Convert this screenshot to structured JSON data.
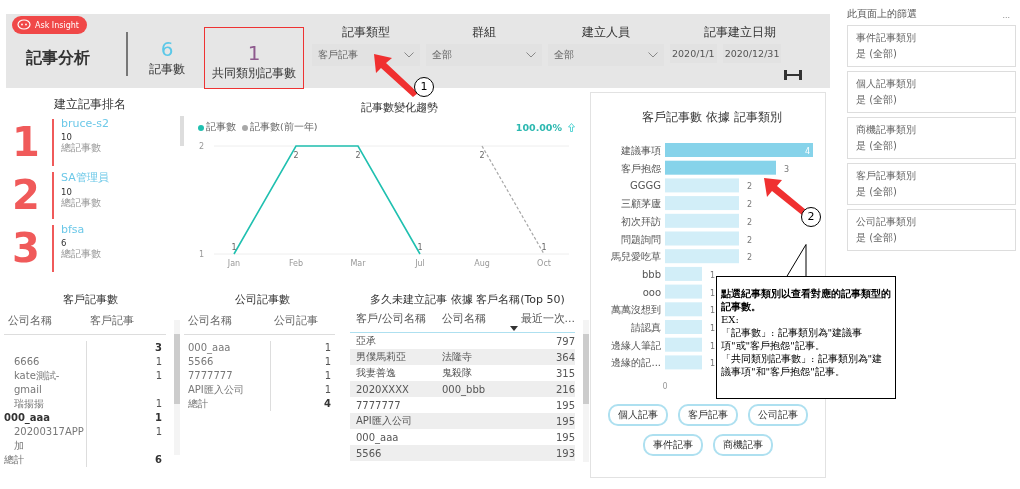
{
  "ask_button": {
    "label": "Ask Insight"
  },
  "title": "記事分析",
  "kpis": [
    {
      "value": "6",
      "label": "記事數",
      "color": "#5bc8e8",
      "boxed": false
    },
    {
      "value": "1",
      "label": "共同類別記事數",
      "color": "#8e5a8e",
      "boxed": true
    }
  ],
  "slicers": [
    {
      "kind": "dropdown",
      "title": "記事類型",
      "value": "客戶記事"
    },
    {
      "kind": "dropdown",
      "title": "群組",
      "value": "全部"
    },
    {
      "kind": "dropdown",
      "title": "建立人員",
      "value": "全部"
    },
    {
      "kind": "date_range",
      "title": "記事建立日期",
      "start": "2020/1/1",
      "end": "2020/12/31"
    }
  ],
  "ranking": {
    "title": "建立記事排名",
    "items": [
      {
        "rank": "1",
        "name": "bruce-s2",
        "count": "10",
        "caption": "總記事數"
      },
      {
        "rank": "2",
        "name": "SA管理員",
        "count": "10",
        "caption": "總記事數"
      },
      {
        "rank": "3",
        "name": "bfsa",
        "count": "6",
        "caption": "總記事數"
      }
    ]
  },
  "trend_chart": {
    "title": "記事數變化趨勢",
    "change": "100.00%",
    "chart_data": {
      "type": "line",
      "categories": [
        "Jan",
        "Feb",
        "Mar",
        "Jul",
        "Aug",
        "Oct"
      ],
      "yticks": [
        1,
        2
      ],
      "ylim": [
        1,
        2
      ],
      "data_labels": true,
      "series": [
        {
          "name": "記事數",
          "color": "#20c0b0",
          "line_style": "solid",
          "values": [
            1,
            2,
            2,
            1,
            null,
            null
          ]
        },
        {
          "name": "記事數(前一年)",
          "color": "#a8a8a8",
          "line_style": "dashed",
          "values": [
            null,
            null,
            null,
            null,
            2,
            1
          ]
        }
      ]
    }
  },
  "customer_table": {
    "title": "客戶記事數",
    "columns": [
      "公司名稱",
      "客戶記事"
    ],
    "rows": [
      {
        "kind": "group",
        "value": "3"
      },
      {
        "kind": "item",
        "name": "6666",
        "value": "1"
      },
      {
        "kind": "item",
        "name": "kate測試-gmail",
        "value": "1"
      },
      {
        "kind": "item",
        "name": "瑞揚揚",
        "value": "1"
      },
      {
        "kind": "group",
        "name": "000_aaa",
        "value": "1"
      },
      {
        "kind": "item",
        "name": "20200317APP加",
        "value": "1"
      }
    ],
    "total": {
      "name": "總計",
      "value": "6"
    }
  },
  "company_table": {
    "title": "公司記事數",
    "columns": [
      "公司名稱",
      "公司記事"
    ],
    "rows": [
      {
        "name": "000_aaa",
        "value": "1"
      },
      {
        "name": "5566",
        "value": "1"
      },
      {
        "name": "7777777",
        "value": "1"
      },
      {
        "name": "API匯入公司",
        "value": "1"
      }
    ],
    "total": {
      "name": "總計",
      "value": "4"
    }
  },
  "idle_table": {
    "title": "多久未建立記事 依據 客戶名稱(Top 50)",
    "columns": [
      "客戶/公司名稱",
      "公司名稱",
      "最近一次..."
    ],
    "rows": [
      {
        "customer": "亞承",
        "days": "797"
      },
      {
        "customer": "男僕馬莉亞",
        "company": "法隆寺",
        "days": "364"
      },
      {
        "customer": "我妻善逸",
        "company": "鬼殺隊",
        "days": "315"
      },
      {
        "customer": "2020XXXX",
        "company": "000_bbb",
        "days": "216"
      },
      {
        "customer": "7777777",
        "days": "195"
      },
      {
        "customer": "API匯入公司",
        "days": "195"
      },
      {
        "customer": "000_aaa",
        "days": "195"
      },
      {
        "customer": "5566",
        "days": "193"
      }
    ]
  },
  "category_chart": {
    "title": "客戶記事數 依據 記事類別",
    "selected": [
      true,
      true,
      false,
      false,
      false,
      false,
      false,
      false,
      false,
      false,
      false,
      false,
      false
    ],
    "axis_start": "0",
    "chart_data": {
      "type": "bar",
      "orientation": "horizontal",
      "data_labels": true,
      "categories": [
        "建議事項",
        "客戶抱怨",
        "GGGG",
        "三顧茅廬",
        "初次拜訪",
        "問題詢問",
        "馬兒愛吃草",
        "bbb",
        "ooo",
        "萬萬沒想到",
        "請認真",
        "邊緣人筆記",
        "邊緣的記..."
      ],
      "values": [
        4,
        3,
        2,
        2,
        2,
        2,
        2,
        1,
        1,
        1,
        1,
        1,
        1
      ]
    }
  },
  "note_buttons": [
    "個人記事",
    "客戶記事",
    "公司記事",
    "事件記事",
    "商機記事"
  ],
  "filter_pane": {
    "title": "此頁面上的篩選",
    "more": "...",
    "cards": [
      {
        "name": "事件記事類別",
        "value": "是 (全部)"
      },
      {
        "name": "個人記事類別",
        "value": "是 (全部)"
      },
      {
        "name": "商機記事類別",
        "value": "是 (全部)"
      },
      {
        "name": "客戶記事類別",
        "value": "是 (全部)"
      },
      {
        "name": "公司記事類別",
        "value": "是 (全部)"
      }
    ]
  },
  "annotations": [
    {
      "number": "1"
    },
    {
      "number": "2"
    }
  ],
  "callout": {
    "heading": "點選紀事類別以查看對應的記事類型的記事數。",
    "lines": [
      "EX:",
      "「記事數」: 記事類別為\"建議事項\"或\"客戶抱怨\"記事。",
      "「共同類別記事數」: 記事類別為\"建議事項\"和\"客戶抱怨\"記事。"
    ]
  }
}
